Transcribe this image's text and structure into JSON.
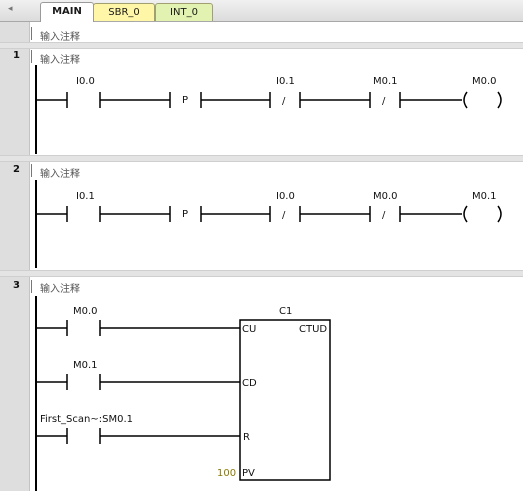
{
  "tabs": [
    {
      "label": "MAIN"
    },
    {
      "label": "SBR_0"
    },
    {
      "label": "INT_0"
    }
  ],
  "header_comment": "输入注释",
  "networks": [
    {
      "number": "1",
      "comment": "输入注释",
      "contacts": [
        "I0.0",
        "I0.1",
        "M0.1"
      ],
      "p_label": "P",
      "nc_symbol": "/",
      "coil": "M0.0"
    },
    {
      "number": "2",
      "comment": "输入注释",
      "contacts": [
        "I0.1",
        "I0.0",
        "M0.0"
      ],
      "p_label": "P",
      "nc_symbol": "/",
      "coil": "M0.1"
    },
    {
      "number": "3",
      "comment": "输入注释",
      "contacts": [
        "M0.0",
        "M0.1",
        "First_Scan~:SM0.1"
      ],
      "counter": {
        "name": "C1",
        "type": "CTUD",
        "pins": [
          "CU",
          "CD",
          "R",
          "PV"
        ],
        "pv_value": "100"
      }
    }
  ],
  "colors": {
    "pv_value": "#8a7a00",
    "rail": "#000000"
  }
}
